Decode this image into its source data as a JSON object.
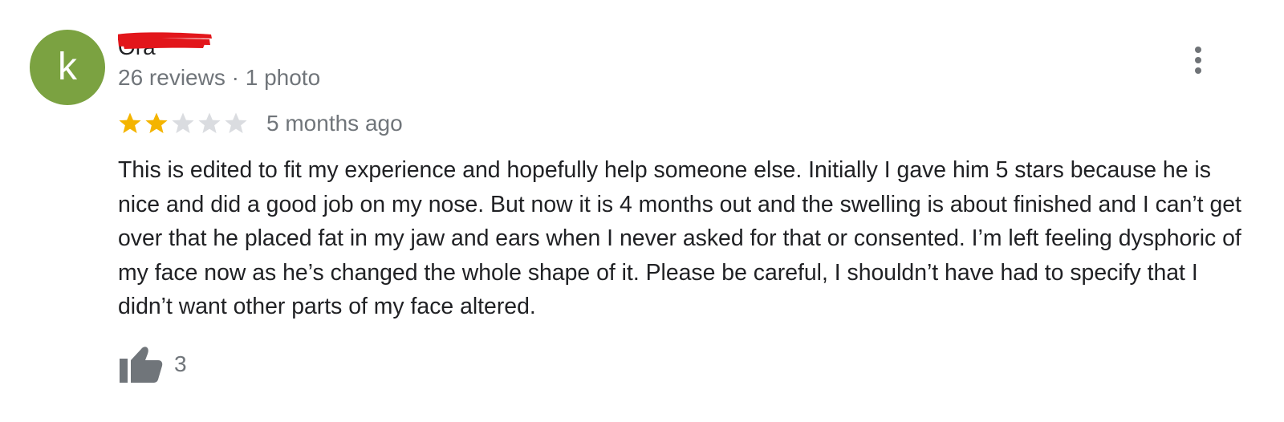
{
  "review": {
    "author": {
      "initial": "k",
      "name": "Ora",
      "avatar_color": "#7ba241",
      "name_redacted": true,
      "redaction_color": "#e2161b"
    },
    "author_stats": "26 reviews · 1 photo",
    "rating": {
      "value": 2,
      "max": 5,
      "filled_color": "#f4b400",
      "empty_color": "#dadce0"
    },
    "time_ago": "5 months ago",
    "text": "This is edited to fit my experience and hopefully help someone else. Initially I gave him 5 stars because he is nice and did a good job on my nose. But now it is 4 months out and the swelling is about finished and I can’t get over that he placed fat in my jaw and ears when I never asked for that or consented. I’m left feeling dysphoric of my face now as he’s changed the whole shape of it. Please be careful, I shouldn’t have had to specify that I didn’t want other parts of my face altered.",
    "likes": {
      "count": "3",
      "icon": "thumbs-up-icon"
    },
    "menu_icon": "more-vert-icon"
  }
}
